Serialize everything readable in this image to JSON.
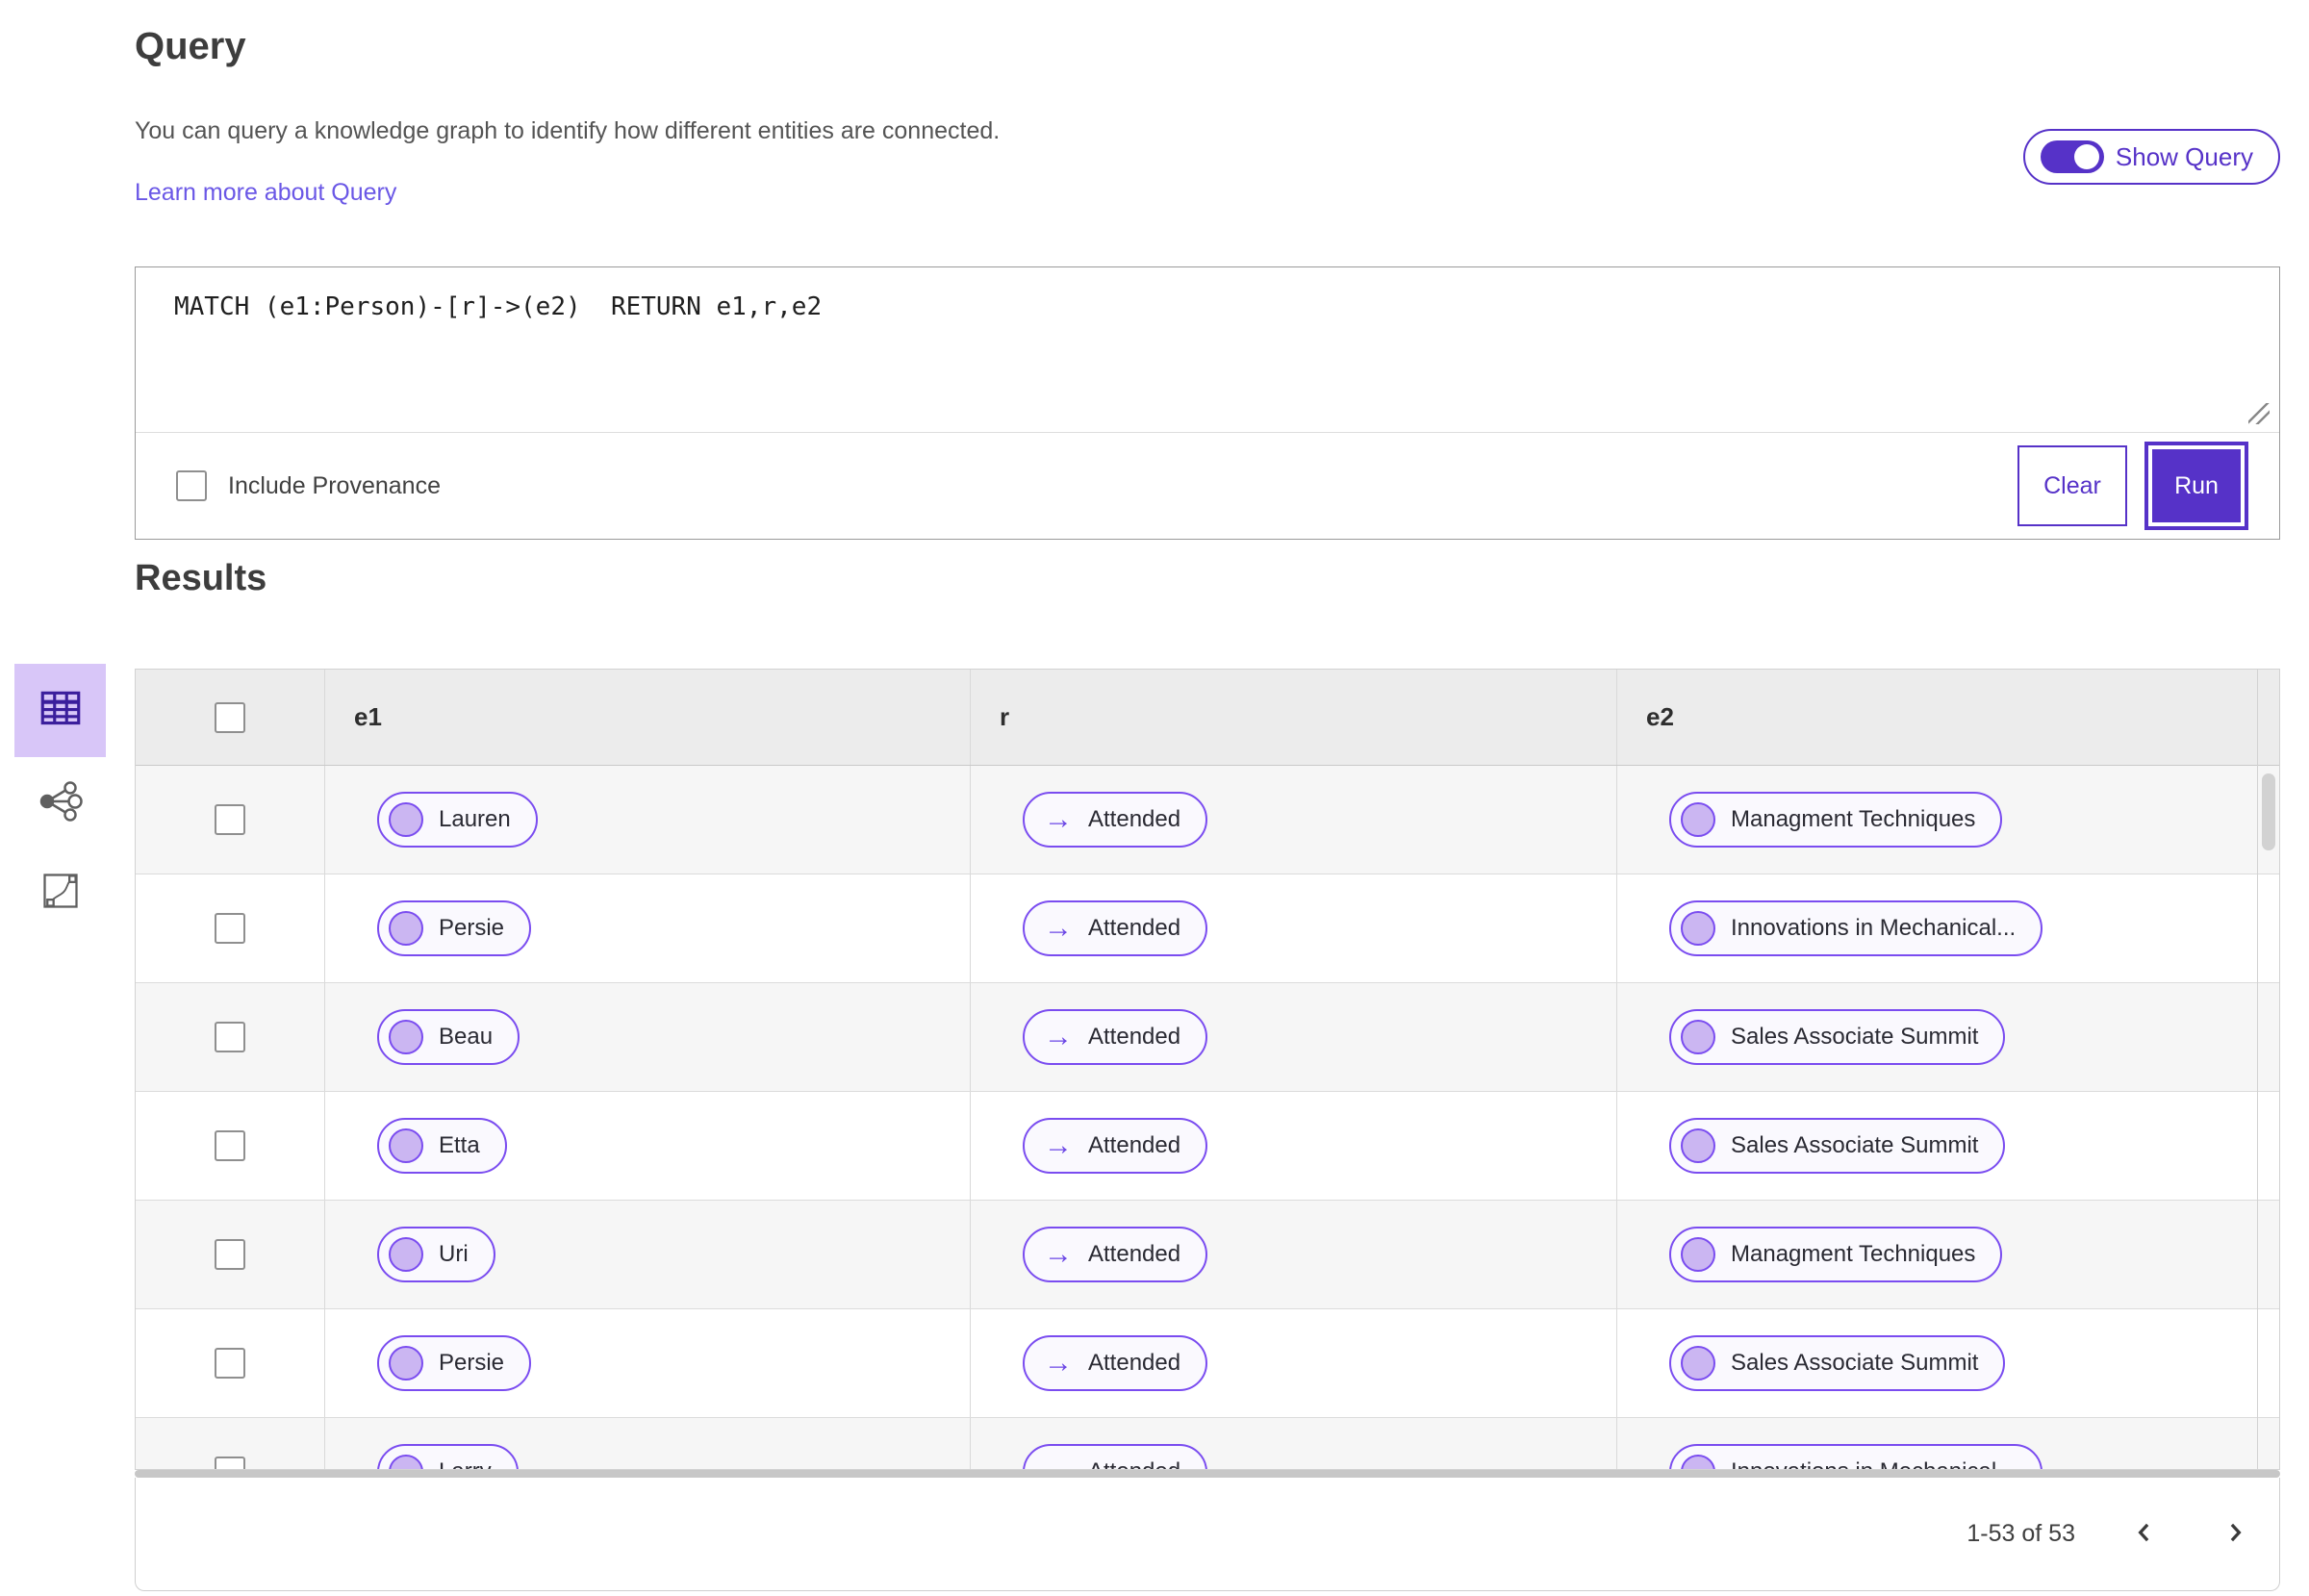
{
  "colors": {
    "accent": "#5632c8",
    "pill-border": "#7a4cf0",
    "link": "#6a57e6",
    "selected-view-bg": "#d8c6f8"
  },
  "icons": {
    "arrow_right": "→"
  },
  "page": {
    "title": "Query",
    "description": "You can query a knowledge graph to identify how different entities are connected.",
    "learn_more": "Learn more about Query",
    "show_query_label": "Show Query",
    "show_query_on": true
  },
  "query_panel": {
    "query_text": "MATCH (e1:Person)-[r]->(e2)  RETURN e1,r,e2",
    "include_provenance_label": "Include Provenance",
    "include_provenance_checked": false,
    "clear_label": "Clear",
    "run_label": "Run"
  },
  "results": {
    "title": "Results",
    "views": [
      "table-view",
      "graph-view",
      "chart-view"
    ],
    "selected_view": "table-view",
    "columns": [
      "e1",
      "r",
      "e2"
    ],
    "rows": [
      {
        "e1": "Lauren",
        "r": "Attended",
        "e2": "Managment Techniques"
      },
      {
        "e1": "Persie",
        "r": "Attended",
        "e2": "Innovations in Mechanical..."
      },
      {
        "e1": "Beau",
        "r": "Attended",
        "e2": "Sales Associate Summit"
      },
      {
        "e1": "Etta",
        "r": "Attended",
        "e2": "Sales Associate Summit"
      },
      {
        "e1": "Uri",
        "r": "Attended",
        "e2": "Managment Techniques"
      },
      {
        "e1": "Persie",
        "r": "Attended",
        "e2": "Sales Associate Summit"
      },
      {
        "e1": "Larry",
        "r": "Attended",
        "e2": "Innovations in Mechanical..."
      }
    ],
    "pagination": {
      "range_label": "1-53 of 53"
    }
  }
}
